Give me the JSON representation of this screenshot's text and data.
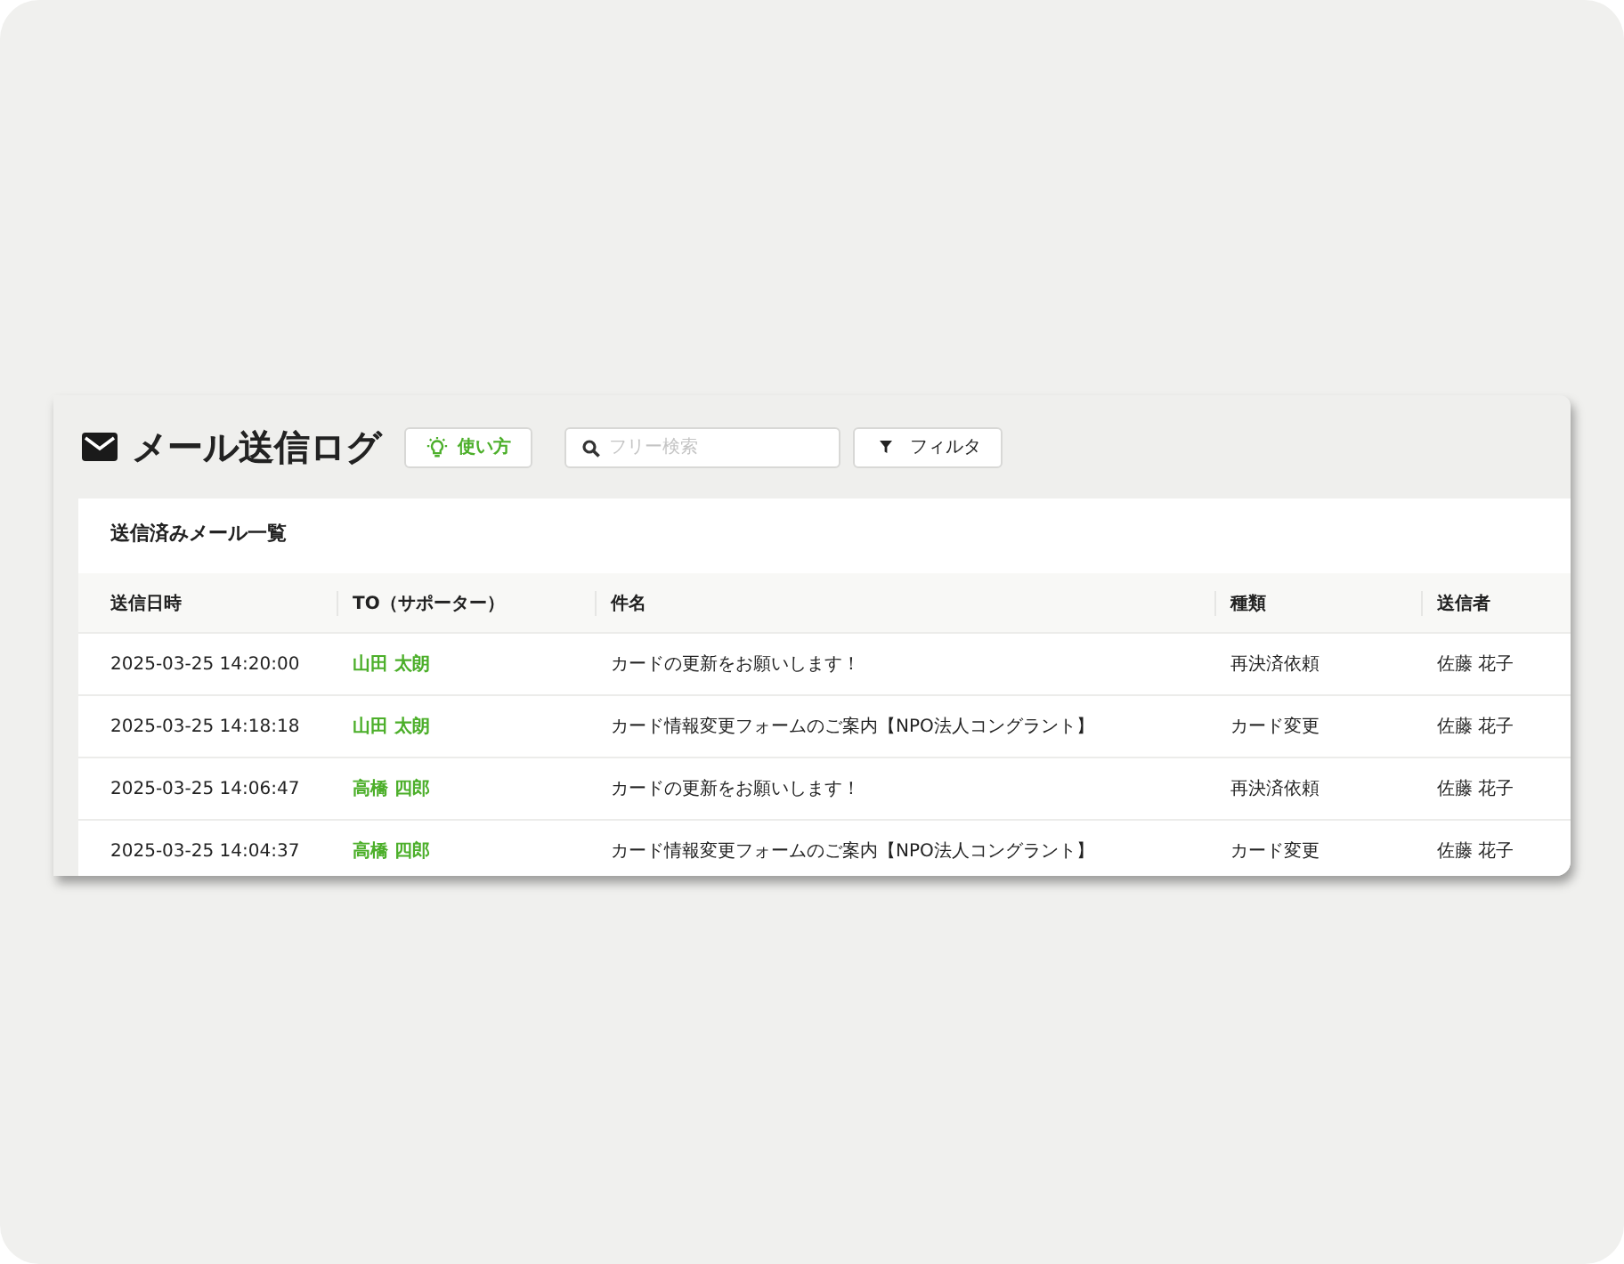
{
  "header": {
    "title": "メール送信ログ",
    "help_button": "使い方",
    "search": {
      "placeholder": "フリー検索"
    },
    "filter_button": "フィルタ"
  },
  "card": {
    "title": "送信済みメール一覧"
  },
  "table": {
    "columns": [
      "送信日時",
      "TO（サポーター）",
      "件名",
      "種類",
      "送信者"
    ],
    "rows": [
      {
        "sent_at": "2025-03-25 14:20:00",
        "to": "山田 太朗",
        "subject": "カードの更新をお願いします！",
        "type": "再決済依頼",
        "sender": "佐藤 花子"
      },
      {
        "sent_at": "2025-03-25 14:18:18",
        "to": "山田 太朗",
        "subject": "カード情報変更フォームのご案内【NPO法人コングラント】",
        "type": "カード変更",
        "sender": "佐藤 花子"
      },
      {
        "sent_at": "2025-03-25 14:06:47",
        "to": "高橋 四郎",
        "subject": "カードの更新をお願いします！",
        "type": "再決済依頼",
        "sender": "佐藤 花子"
      },
      {
        "sent_at": "2025-03-25 14:04:37",
        "to": "高橋 四郎",
        "subject": "カード情報変更フォームのご案内【NPO法人コングラント】",
        "type": "カード変更",
        "sender": "佐藤 花子"
      }
    ]
  }
}
